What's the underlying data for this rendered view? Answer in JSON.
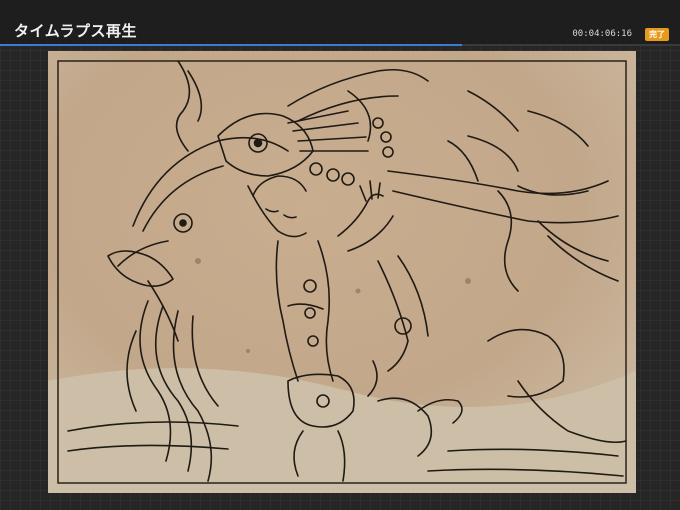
{
  "header": {
    "title": "タイムラプス再生",
    "elapsed_time": "00:04:06:16",
    "done_label": "完了"
  },
  "playback": {
    "progress_fraction": 0.68
  },
  "colors": {
    "accent_progress": "#3e7bd6",
    "done_button": "#e89a1c",
    "paper": "#cbb9a0",
    "ink": "#1f1a14"
  },
  "canvas": {
    "artwork_subject": "ink-sketch-illustration"
  }
}
